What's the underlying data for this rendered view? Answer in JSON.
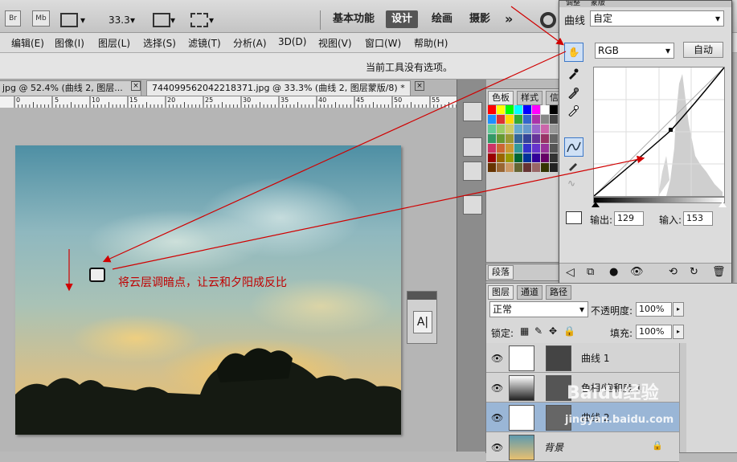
{
  "app": {
    "br_label": "Br",
    "mb_label": "Mb",
    "zoom": "33.3",
    "workspaces": [
      "基本功能",
      "设计",
      "绘画",
      "摄影"
    ],
    "active_workspace": "设计",
    "more": "»"
  },
  "menu": [
    "编辑(E)",
    "图像(I)",
    "图层(L)",
    "选择(S)",
    "滤镜(T)",
    "分析(A)",
    "3D(D)",
    "视图(V)",
    "窗口(W)",
    "帮助(H)"
  ],
  "options_bar": {
    "message": "当前工具没有选项。"
  },
  "tabs": [
    {
      "label": "jpg @ 52.4% (曲线 2, 图层..."
    },
    {
      "label": "744099562042218371.jpg @ 33.3% (曲线 2, 图层蒙版/8) *"
    }
  ],
  "ruler": {
    "ticks": [
      "0",
      "5",
      "10",
      "15",
      "20",
      "25",
      "30",
      "35",
      "40",
      "45",
      "50",
      "55"
    ]
  },
  "annotation": {
    "text": "将云层调暗点，让云和夕阳成反比"
  },
  "swatches_panel": {
    "tabs": [
      "色板",
      "样式",
      "信"
    ]
  },
  "paragraph_panel": {
    "tab": "段落"
  },
  "adjustments_panel": {
    "tabs": [
      "调整",
      "蒙版"
    ],
    "title": "曲线",
    "preset": "自定",
    "channel": "RGB",
    "auto_button": "自动",
    "output_label": "输出:",
    "output_value": "129",
    "input_label": "输入:",
    "input_value": "153"
  },
  "layers_panel": {
    "tabs": [
      "图层",
      "通道",
      "路径"
    ],
    "blend_mode": "正常",
    "opacity_label": "不透明度:",
    "opacity_value": "100%",
    "lock_label": "锁定:",
    "fill_label": "填充:",
    "fill_value": "100%",
    "layers": [
      {
        "name": "曲线 1",
        "selected": false
      },
      {
        "name": "色相/饱和度 1",
        "selected": false
      },
      {
        "name": "曲线 2",
        "selected": true
      },
      {
        "name": "背景",
        "selected": false
      }
    ]
  },
  "watermark": {
    "brand": "Baidu经验",
    "url": "jingyan.baidu.com"
  },
  "colors": {
    "annotation_red": "#d00000",
    "accent_blue": "#3c78c8"
  }
}
